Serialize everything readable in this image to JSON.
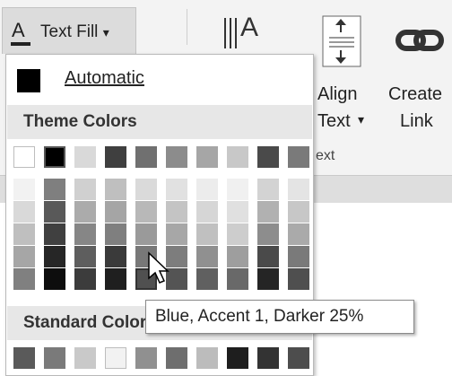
{
  "ribbon": {
    "text_fill_label": "Text Fill",
    "text_fill_glyph": "A",
    "text_fill_caret": "▾",
    "text_direction_glyph": "A",
    "align_label_1": "Align",
    "align_label_2": "Text",
    "align_caret": "▾",
    "create_label_1": "Create",
    "create_label_2": "Link",
    "group_label_fragment": "ext"
  },
  "dropdown": {
    "automatic_label": "Automatic",
    "automatic_color": "#000000",
    "theme_colors_heading": "Theme Colors",
    "standard_colors_heading": "Standard Colors",
    "theme_top_row": [
      "#ffffff",
      "#000000",
      "#d9d9d9",
      "#3f3f3f",
      "#707070",
      "#8c8c8c",
      "#a6a6a6",
      "#c8c8c8",
      "#4a4a4a",
      "#7a7a7a"
    ],
    "theme_shades": [
      [
        "#f2f2f2",
        "#7f7f7f",
        "#d0d0d0",
        "#bfbfbf",
        "#dadada",
        "#e1e1e1",
        "#ececec",
        "#f0f0f0",
        "#d3d3d3",
        "#e4e4e4"
      ],
      [
        "#d9d9d9",
        "#595959",
        "#ababab",
        "#a5a5a5",
        "#b8b8b8",
        "#c4c4c4",
        "#d6d6d6",
        "#e0e0e0",
        "#b1b1b1",
        "#c7c7c7"
      ],
      [
        "#bfbfbf",
        "#404040",
        "#868686",
        "#7f7f7f",
        "#9a9a9a",
        "#a7a7a7",
        "#c0c0c0",
        "#cdcdcd",
        "#8d8d8d",
        "#aaaaaa"
      ],
      [
        "#a6a6a6",
        "#262626",
        "#5e5e5e",
        "#3a3a3a",
        "#787878",
        "#7d7d7d",
        "#909090",
        "#9e9e9e",
        "#4a4a4a",
        "#7a7a7a"
      ],
      [
        "#808080",
        "#0d0d0d",
        "#3c3c3c",
        "#1f1f1f",
        "#505050",
        "#545454",
        "#606060",
        "#696969",
        "#252525",
        "#4f4f4f"
      ]
    ],
    "standard_colors": [
      "#5a5a5a",
      "#7a7a7a",
      "#c9c9c9",
      "#f2f2f2",
      "#909090",
      "#6e6e6e",
      "#bcbcbc",
      "#1e1e1e",
      "#333333",
      "#4d4d4d"
    ],
    "hovered_swatch": {
      "column": 4,
      "shade_row": 4,
      "color": "#545454"
    }
  },
  "tooltip": {
    "text": "Blue, Accent 1, Darker 25%"
  }
}
